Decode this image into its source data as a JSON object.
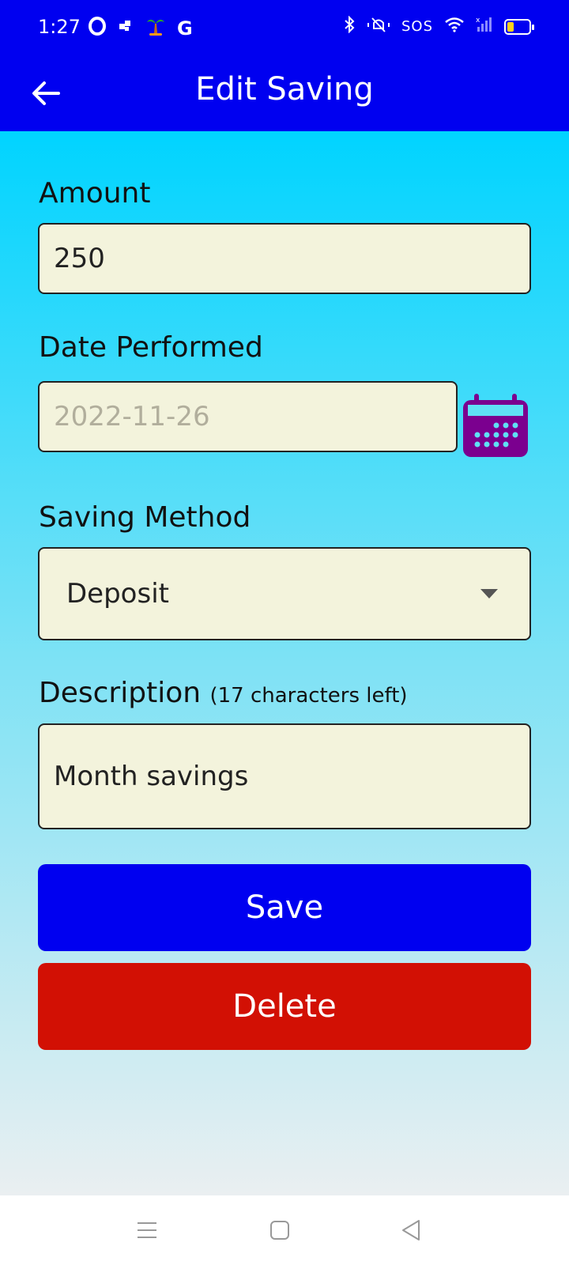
{
  "status_bar": {
    "time": "1:27",
    "sos": "SOS",
    "left_icons": [
      "opera-icon",
      "puzzle-icon",
      "palm-tree-icon",
      "google-icon"
    ],
    "right_icons": [
      "bluetooth-icon",
      "muted-bell-icon",
      "sos-text",
      "wifi-icon",
      "signal-icon",
      "battery-icon"
    ],
    "battery_level": 0.3
  },
  "app_bar": {
    "title": "Edit Saving",
    "back_icon": "arrow-left-icon",
    "background": "#0000f0"
  },
  "form": {
    "amount_label": "Amount",
    "amount_value": "250",
    "date_label": "Date Performed",
    "date_value": "2022-11-26",
    "calendar_icon": "calendar-icon",
    "method_label": "Saving Method",
    "method_value": "Deposit",
    "description_label": "Description",
    "description_counter": "(17 characters left)",
    "description_value": "Month savings"
  },
  "buttons": {
    "save_label": "Save",
    "save_color": "#0000f0",
    "delete_label": "Delete",
    "delete_color": "#d21004"
  },
  "nav_bar": {
    "icons": [
      "menu-icon",
      "home-square-icon",
      "back-triangle-icon"
    ]
  }
}
